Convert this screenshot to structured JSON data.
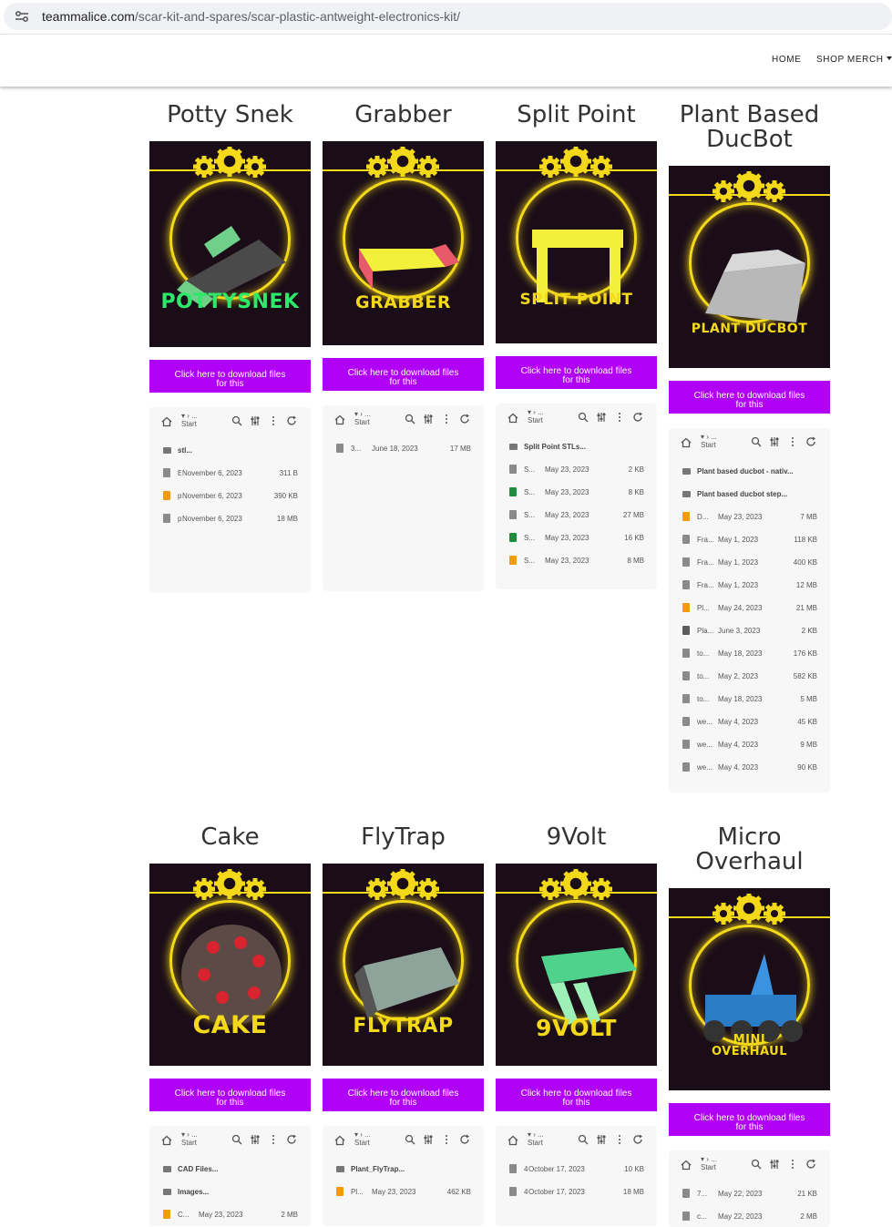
{
  "browser": {
    "url_host": "teammalice.com",
    "url_path": "/scar-kit-and-spares/scar-plastic-antweight-electronics-kit/"
  },
  "nav": {
    "home": "HOME",
    "shop": "SHOP MERCH"
  },
  "button_label": "Click here to download files\nfor this",
  "file_header": {
    "crumb": "▾   › ...\n  Start"
  },
  "colors": {
    "accent": "#b000f5",
    "gold": "#f4d91a",
    "poster_bg": "#1a0d18"
  },
  "cards": [
    {
      "title": "Potty Snek",
      "poster_label": "POTTYSNEK",
      "poster_color": "#2ee86a",
      "files": [
        {
          "kind": "folder",
          "name": "stl..."
        },
        {
          "kind": "file",
          "icon": "gray",
          "name": "E",
          "date": "November 6, 2023",
          "size": "311 B"
        },
        {
          "kind": "file",
          "icon": "orange",
          "name": "p",
          "date": "November 6, 2023",
          "size": "390 KB"
        },
        {
          "kind": "file",
          "icon": "gray",
          "name": "p",
          "date": "November 6, 2023",
          "size": "18 MB"
        }
      ]
    },
    {
      "title": "Grabber",
      "poster_label": "GRABBER",
      "poster_color": "#f4d91a",
      "files": [
        {
          "kind": "file",
          "icon": "gray",
          "name": "3...",
          "date": "June 18, 2023",
          "size": "17 MB"
        }
      ]
    },
    {
      "title": "Split Point",
      "poster_label": "SPLIT POINT",
      "poster_color": "#f4d91a",
      "files": [
        {
          "kind": "folder",
          "name": "Split Point STLs..."
        },
        {
          "kind": "file",
          "icon": "gray",
          "name": "S...",
          "date": "May 23, 2023",
          "size": "2 KB"
        },
        {
          "kind": "file",
          "icon": "green",
          "name": "S...",
          "date": "May 23, 2023",
          "size": "8 KB"
        },
        {
          "kind": "file",
          "icon": "gray",
          "name": "S...",
          "date": "May 23, 2023",
          "size": "27 MB"
        },
        {
          "kind": "file",
          "icon": "green",
          "name": "S...",
          "date": "May 23, 2023",
          "size": "16 KB"
        },
        {
          "kind": "file",
          "icon": "orange",
          "name": "S...",
          "date": "May 23, 2023",
          "size": "8 MB"
        }
      ]
    },
    {
      "title": "Plant Based\nDucBot",
      "poster_label": "PLANT DUCBOT",
      "poster_color": "#f4d91a",
      "files": [
        {
          "kind": "folder",
          "name": "Plant based ducbot - nativ..."
        },
        {
          "kind": "folder",
          "name": "Plant based ducbot step..."
        },
        {
          "kind": "file",
          "icon": "orange",
          "name": "D...",
          "date": "May 23, 2023",
          "size": "7 MB"
        },
        {
          "kind": "file",
          "icon": "gray",
          "name": "Fra...",
          "date": "May 1, 2023",
          "size": "118 KB"
        },
        {
          "kind": "file",
          "icon": "gray",
          "name": "Fra...",
          "date": "May 1, 2023",
          "size": "400 KB"
        },
        {
          "kind": "file",
          "icon": "gray",
          "name": "Fra...",
          "date": "May 1, 2023",
          "size": "12 MB"
        },
        {
          "kind": "file",
          "icon": "orange",
          "name": "Pl...",
          "date": "May 24, 2023",
          "size": "21 MB"
        },
        {
          "kind": "file",
          "icon": "dark",
          "name": "Pla...",
          "date": "June 3, 2023",
          "size": "2 KB"
        },
        {
          "kind": "file",
          "icon": "gray",
          "name": "to...",
          "date": "May 18, 2023",
          "size": "176 KB"
        },
        {
          "kind": "file",
          "icon": "gray",
          "name": "to...",
          "date": "May 2, 2023",
          "size": "582 KB"
        },
        {
          "kind": "file",
          "icon": "gray",
          "name": "to...",
          "date": "May 18, 2023",
          "size": "5 MB"
        },
        {
          "kind": "file",
          "icon": "gray",
          "name": "we...",
          "date": "May 4, 2023",
          "size": "45 KB"
        },
        {
          "kind": "file",
          "icon": "gray",
          "name": "we...",
          "date": "May 4, 2023",
          "size": "9 MB"
        },
        {
          "kind": "file",
          "icon": "gray",
          "name": "we...",
          "date": "May 4, 2023",
          "size": "90 KB"
        }
      ]
    },
    {
      "title": "Cake",
      "poster_label": "CAKE",
      "poster_color": "#f4d91a",
      "files": [
        {
          "kind": "folder",
          "name": "CAD Files..."
        },
        {
          "kind": "folder",
          "name": "Images..."
        },
        {
          "kind": "file",
          "icon": "orange",
          "name": "C...",
          "date": "May 23, 2023",
          "size": "2 MB"
        }
      ]
    },
    {
      "title": "FlyTrap",
      "poster_label": "FLYTRAP",
      "poster_color": "#f4d91a",
      "files": [
        {
          "kind": "folder",
          "name": "Plant_FlyTrap..."
        },
        {
          "kind": "file",
          "icon": "orange",
          "name": "Pl...",
          "date": "May 23, 2023",
          "size": "462 KB"
        }
      ]
    },
    {
      "title": "9Volt",
      "poster_label": "9VOLT",
      "poster_color": "#f4d91a",
      "files": [
        {
          "kind": "file",
          "icon": "gray",
          "name": "4",
          "date": "October 17, 2023",
          "size": "10 KB"
        },
        {
          "kind": "file",
          "icon": "gray",
          "name": "4",
          "date": "October 17, 2023",
          "size": "18 MB"
        }
      ]
    },
    {
      "title": "Micro\nOverhaul",
      "poster_label": "MINI\nOVERHAUL",
      "poster_color": "#f4d91a",
      "files": [
        {
          "kind": "file",
          "icon": "gray",
          "name": "7...",
          "date": "May 22, 2023",
          "size": "21 KB"
        },
        {
          "kind": "file",
          "icon": "gray",
          "name": "c...",
          "date": "May 22, 2023",
          "size": "2 MB"
        }
      ]
    }
  ]
}
